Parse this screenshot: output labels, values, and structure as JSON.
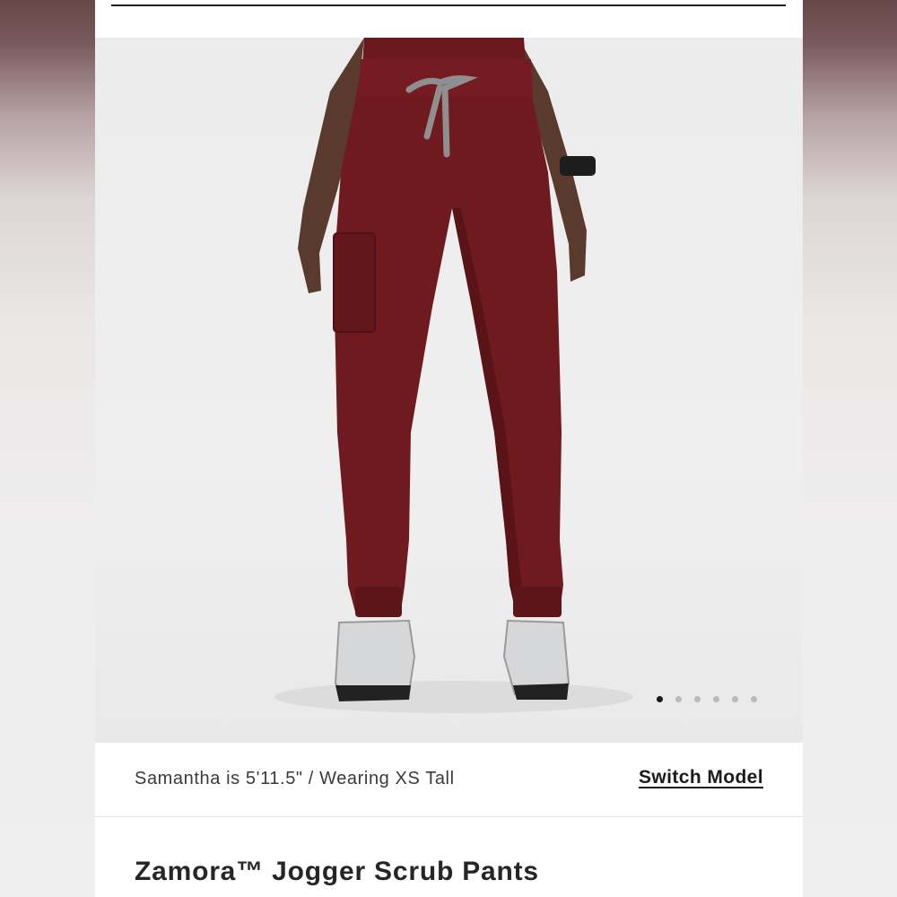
{
  "product": {
    "title": "Zamora™ Jogger Scrub Pants",
    "model_caption": "Samantha is 5'11.5\" / Wearing XS Tall",
    "switch_model_label": "Switch Model",
    "garment_color": "#6e1a1f",
    "drawstring_color": "#8f8f8f"
  },
  "gallery": {
    "total_images": 6,
    "active_index": 0
  },
  "icons": {
    "drawstring": "drawstring-icon",
    "watch": "watch-icon"
  }
}
